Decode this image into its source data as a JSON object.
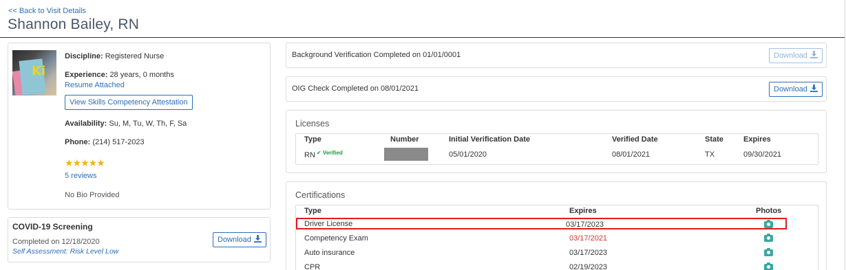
{
  "nav": {
    "back_label": "<< Back to Visit Details"
  },
  "header": {
    "name": "Shannon Bailey, RN"
  },
  "profile": {
    "discipline_label": "Discipline:",
    "discipline_value": "Registered Nurse",
    "experience_label": "Experience:",
    "experience_value": "28 years, 0 months",
    "resume_link": "Resume Attached",
    "skills_button": "View Skills Competency Attestation",
    "availability_label": "Availability:",
    "availability_value": "Su, M, Tu, W, Th, F, Sa",
    "phone_label": "Phone:",
    "phone_value": "(214) 517-2023",
    "rating_stars": "★★★★★",
    "rating": 5,
    "reviews_link": "5 reviews",
    "bio": "No Bio Provided"
  },
  "covid": {
    "title": "COVID-19 Screening",
    "completed": "Completed on 12/18/2020",
    "assessment": "Self Assessment: Risk Level Low",
    "download_label": "Download"
  },
  "checks": {
    "background_text": "Background Verification Completed on 01/01/0001",
    "background_download": "Download",
    "oig_text": "OIG Check Completed on 08/01/2021",
    "oig_download": "Download"
  },
  "licenses": {
    "title": "Licenses",
    "headers": [
      "Type",
      "Number",
      "Initial Verification Date",
      "Verified Date",
      "State",
      "Expires"
    ],
    "rows": [
      {
        "type": "RN",
        "badge": "✔ Verified",
        "number": "",
        "initial": "05/01/2020",
        "verified": "08/01/2021",
        "state": "TX",
        "expires": "09/30/2021"
      }
    ]
  },
  "certifications": {
    "title": "Certifications",
    "headers": [
      "Type",
      "Expires",
      "Photos"
    ],
    "rows": [
      {
        "type": "Driver License",
        "expires": "03/17/2023"
      },
      {
        "type": "Competency Exam",
        "expires": "03/17/2021"
      },
      {
        "type": "Auto insurance",
        "expires": "03/17/2023"
      },
      {
        "type": "CPR",
        "expires": "02/19/2023"
      }
    ]
  },
  "colors": {
    "link": "#2a6ebb",
    "star": "#f0b419",
    "verified": "#1e9a3a",
    "expired": "#d9342b",
    "camera": "#3aa8a0",
    "highlight": "#e01b1b"
  }
}
